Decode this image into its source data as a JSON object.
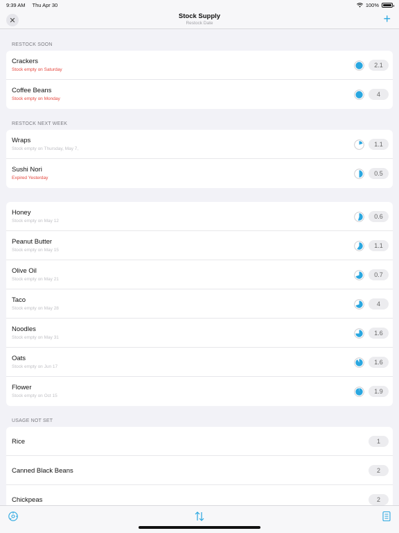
{
  "status": {
    "time": "9:39 AM",
    "date": "Thu Apr 30",
    "battery": "100%"
  },
  "nav": {
    "title": "Stock Supply",
    "subtitle": "Restock Date",
    "close_icon": "close-icon",
    "add_icon": "plus-icon"
  },
  "colors": {
    "accent": "#2aa7e0",
    "warning": "#e5463d"
  },
  "sections": [
    {
      "header": "RESTOCK SOON",
      "items": [
        {
          "name": "Crackers",
          "sub": "Stock empty on Saturday",
          "sub_red": true,
          "fill": 1.0,
          "qty": "2.1"
        },
        {
          "name": "Coffee Beans",
          "sub": "Stock empty on Monday",
          "sub_red": true,
          "fill": 1.0,
          "qty": "4"
        }
      ]
    },
    {
      "header": "RESTOCK NEXT WEEK",
      "items": [
        {
          "name": "Wraps",
          "sub": "Stock empty on Thursday, May 7,",
          "sub_red": false,
          "fill": 0.2,
          "qty": "1.1"
        },
        {
          "name": "Sushi Nori",
          "sub": "Expired Yesterday",
          "sub_red": true,
          "fill": 0.5,
          "qty": "0.5"
        }
      ]
    },
    {
      "header": "",
      "items": [
        {
          "name": "Honey",
          "sub": "Stock empty on May 12",
          "sub_red": false,
          "fill": 0.55,
          "qty": "0.6"
        },
        {
          "name": "Peanut Butter",
          "sub": "Stock empty on May 15",
          "sub_red": false,
          "fill": 0.6,
          "qty": "1.1"
        },
        {
          "name": "Olive Oil",
          "sub": "Stock empty on May 21",
          "sub_red": false,
          "fill": 0.7,
          "qty": "0.7"
        },
        {
          "name": "Taco",
          "sub": "Stock empty on May 28",
          "sub_red": false,
          "fill": 0.7,
          "qty": "4"
        },
        {
          "name": "Noodles",
          "sub": "Stock empty on May 31",
          "sub_red": false,
          "fill": 0.75,
          "qty": "1.6"
        },
        {
          "name": "Oats",
          "sub": "Stock empty on Jun 17",
          "sub_red": false,
          "fill": 0.92,
          "qty": "1.6"
        },
        {
          "name": "Flower",
          "sub": "Stock empty on Oct 15",
          "sub_red": false,
          "fill": 0.98,
          "qty": "1.9"
        }
      ]
    },
    {
      "header": "USAGE NOT SET",
      "items": [
        {
          "name": "Rice",
          "sub": "",
          "qty": "1"
        },
        {
          "name": "Canned Black Beans",
          "sub": "",
          "qty": "2"
        },
        {
          "name": "Chickpeas",
          "sub": "",
          "qty": "2"
        }
      ]
    }
  ],
  "tabs": [
    {
      "icon": "clock-settings-icon"
    },
    {
      "icon": "sort-arrows-icon"
    },
    {
      "icon": "document-icon"
    }
  ]
}
